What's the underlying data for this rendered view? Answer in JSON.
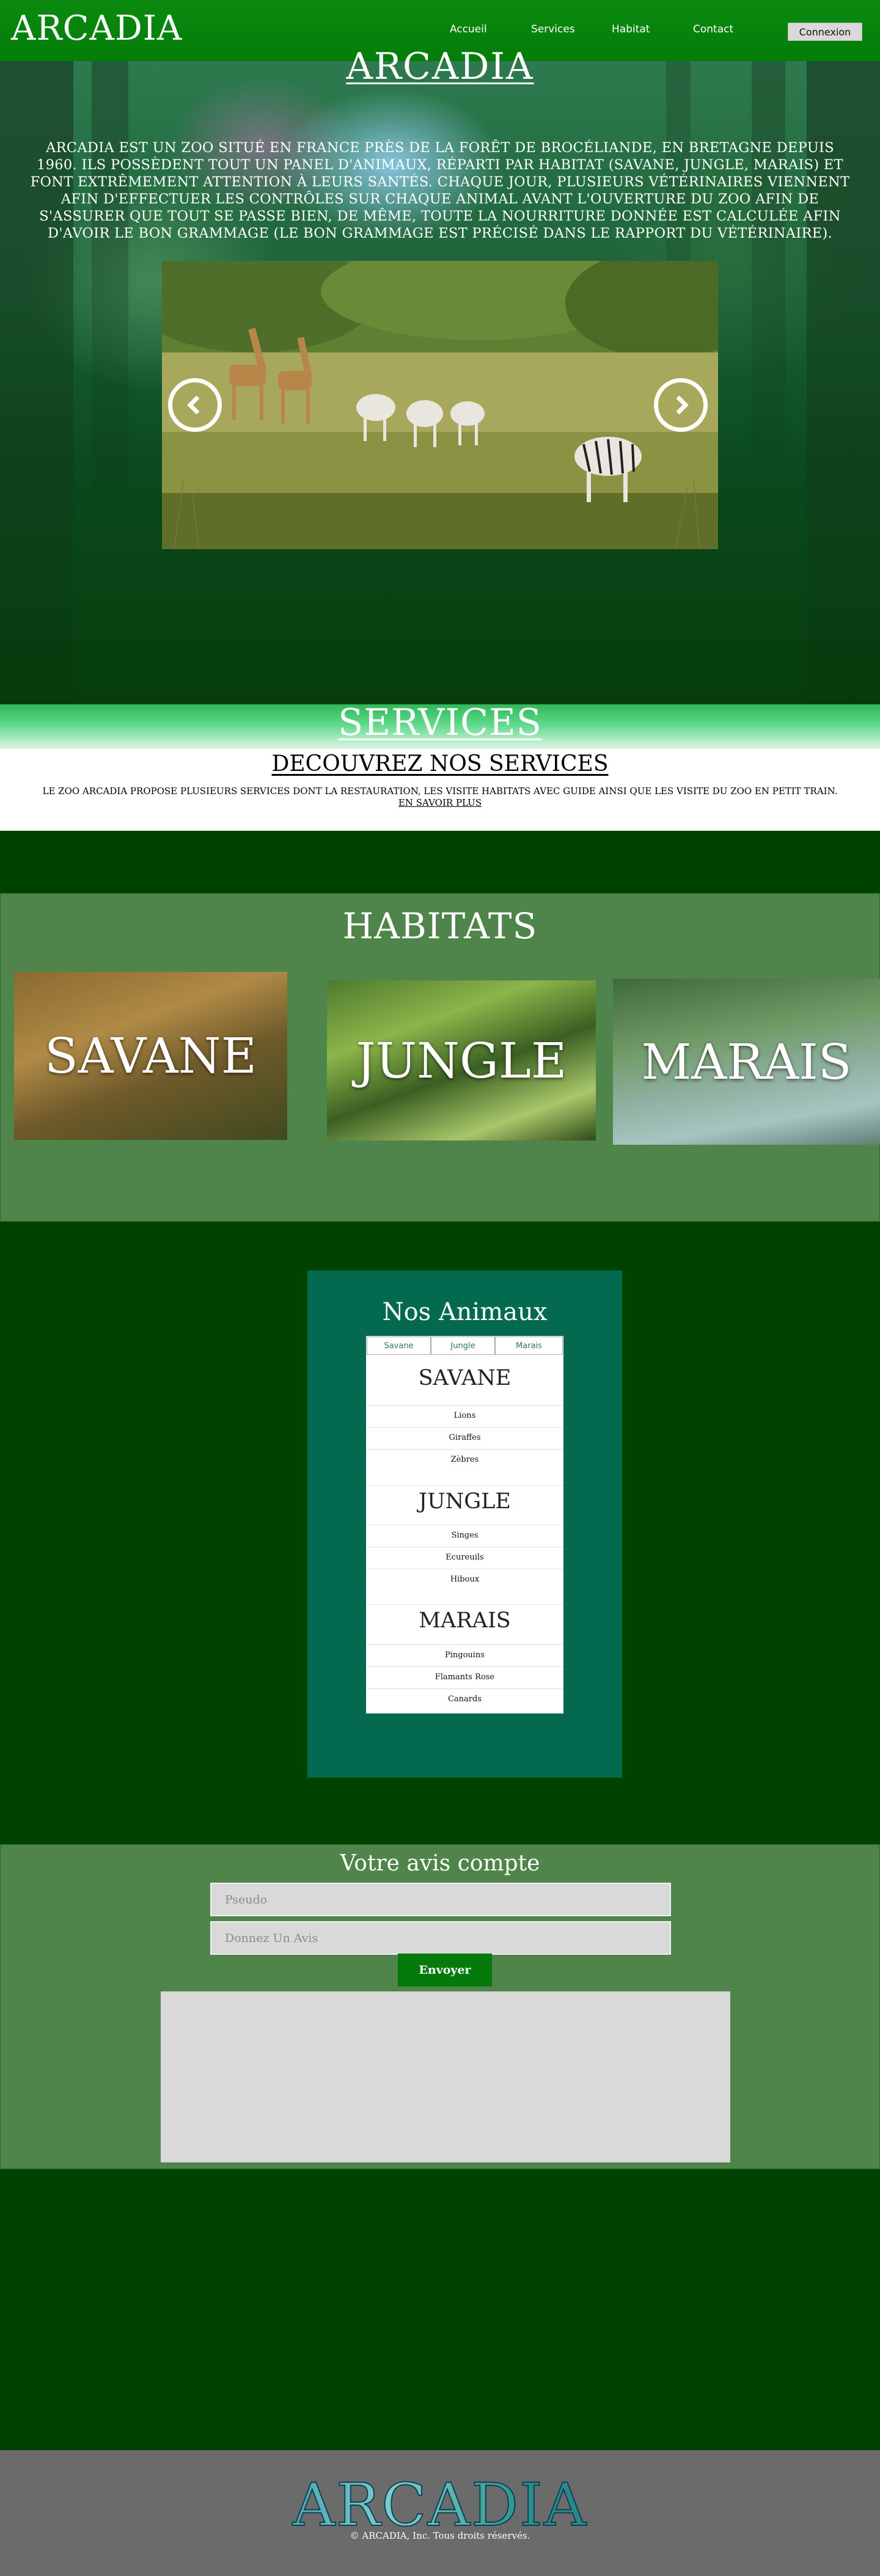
{
  "header": {
    "logo": "ARCADIA",
    "nav": [
      "Accueil",
      "Services",
      "Habitat",
      "Contact"
    ],
    "login_label": "Connexion"
  },
  "hero": {
    "title": "ARCADIA",
    "text": "ARCADIA EST UN ZOO SITUÉ EN FRANCE PRÈS DE LA FORÊT DE BROCÉLIANDE, EN BRETAGNE DEPUIS 1960. ILS POSSÈDENT TOUT UN PANEL D'ANIMAUX, RÉPARTI PAR HABITAT (SAVANE, JUNGLE, MARAIS) ET FONT EXTRÊMEMENT ATTENTION À LEURS SANTÉS. CHAQUE JOUR, PLUSIEURS VÉTÉRINAIRES VIENNENT AFIN D'EFFECTUER LES CONTRÔLES SUR CHAQUE ANIMAL AVANT L'OUVERTURE DU ZOO AFIN DE S'ASSURER QUE TOUT SE PASSE BIEN, DE MÊME, TOUTE LA NOURRITURE DONNÉE EST CALCULÉE AFIN D'AVOIR LE BON GRAMMAGE (LE BON GRAMMAGE EST PRÉCISÉ DANS LE RAPPORT DU VÉTÉRINAIRE).",
    "carousel_prev_icon": "chevron-left-icon",
    "carousel_next_icon": "chevron-right-icon"
  },
  "services": {
    "title": "SERVICES",
    "subtitle": "DECOUVREZ NOS SERVICES",
    "text": "LE ZOO ARCADIA PROPOSE PLUSIEURS SERVICES DONT LA RESTAURATION, LES VISITE HABITATS AVEC GUIDE AINSI QUE LES VISITE DU ZOO EN PETIT TRAIN.",
    "link": "EN SAVOIR PLUS"
  },
  "habitats": {
    "title": "HABITATS",
    "cards": [
      "SAVANE",
      "JUNGLE",
      "MARAIS"
    ]
  },
  "animals": {
    "title": "Nos Animaux",
    "tabs": [
      "Savane",
      "Jungle",
      "Marais"
    ],
    "groups": [
      {
        "name": "SAVANE",
        "items": [
          "Lions",
          "Giraffes",
          "Zèbres"
        ]
      },
      {
        "name": "JUNGLE",
        "items": [
          "Singes",
          "Ecureuils",
          "Hiboux"
        ]
      },
      {
        "name": "MARAIS",
        "items": [
          "Pingouins",
          "Flamants Rose",
          "Canards"
        ]
      }
    ]
  },
  "avis": {
    "title": "Votre avis compte",
    "pseudo_placeholder": "Pseudo",
    "avis_placeholder": "Donnez Un Avis",
    "send_label": "Envoyer"
  },
  "footer": {
    "logo": "ARCADIA",
    "copyright": "© ARCADIA, Inc. Tous droits réservés."
  },
  "colors": {
    "header_green": "#037d0a",
    "page_dark_green": "#004200",
    "section_green": "#4f844a",
    "animals_teal": "#036a4f",
    "footer_grey": "#6b6b6b"
  }
}
